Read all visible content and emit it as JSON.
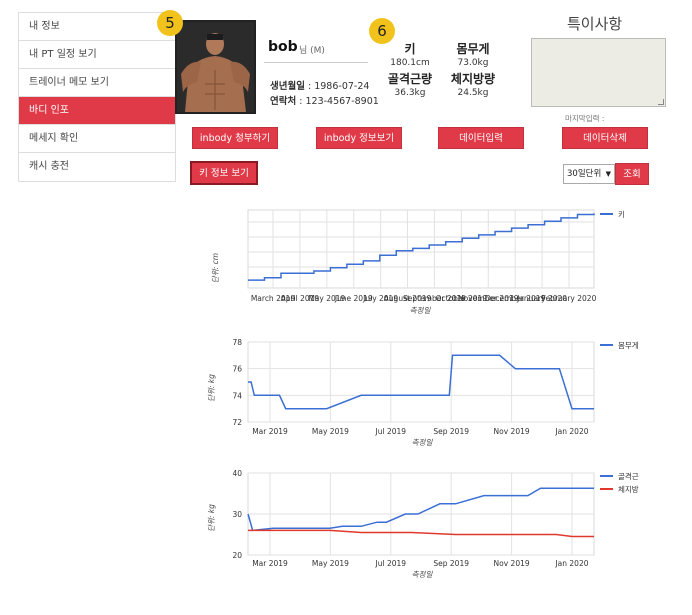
{
  "sidebar": {
    "items": [
      {
        "label": "내 정보",
        "active": false
      },
      {
        "label": "내 PT 일정 보기",
        "active": false
      },
      {
        "label": "트레이너 메모 보기",
        "active": false
      },
      {
        "label": "바디 인포",
        "active": true
      },
      {
        "label": "메세지 확인",
        "active": false
      },
      {
        "label": "캐시 충전",
        "active": false
      }
    ]
  },
  "markers": {
    "left": "5",
    "right": "6"
  },
  "profile": {
    "name": "bob",
    "name_suffix": "님 (M)",
    "birth_label": "생년월일",
    "birth_value": " : 1986-07-24",
    "phone_label": "연락처",
    "phone_value": " : 123-4567-8901"
  },
  "stats": {
    "height_label": "키",
    "height_value": "180.1cm",
    "weight_label": "몸무게",
    "weight_value": "73.0kg",
    "muscle_label": "골격근량",
    "muscle_value": "36.3kg",
    "fat_label": "체지방량",
    "fat_value": "24.5kg"
  },
  "notes": {
    "title": "특이사항",
    "last_input": "마지막입력 :"
  },
  "buttons": {
    "inbody_request": "inbody 청부하기",
    "inbody_view": "inbody 정보보기",
    "data_input": "데이터입력",
    "data_delete": "데이터삭제",
    "key_view": "키 정보 보기",
    "lookup": "조회"
  },
  "period_select": {
    "value": "30일단위"
  },
  "colors": {
    "accent": "#e03a48",
    "line_blue": "#3b6fd4",
    "line_red": "#e0392c",
    "badge": "#f2c21c"
  },
  "chart_data": [
    {
      "type": "line",
      "ylabel": "단위: cm",
      "xlabel": "측정일",
      "x_ticks": [
        "March 2019",
        "April 2019",
        "May 2019",
        "June 2019",
        "July 2019",
        "August 2019",
        "September 2019",
        "October 2019",
        "November 2019",
        "December 2019",
        "January 2020",
        "February 2020"
      ],
      "series": [
        {
          "name": "키",
          "color": "#3b6fd4",
          "values": [
            174.2,
            174.4,
            174.8,
            174.8,
            175.0,
            175.3,
            175.6,
            175.9,
            176.4,
            176.8,
            177.0,
            177.3,
            177.6,
            177.9,
            178.2,
            178.5,
            178.8,
            179.1,
            179.4,
            179.7,
            180.0,
            180.1
          ]
        }
      ]
    },
    {
      "type": "line",
      "ylabel": "단위: kg",
      "xlabel": "측정일",
      "y_ticks": [
        "72",
        "74",
        "76",
        "78"
      ],
      "ylim": [
        72,
        78
      ],
      "x_ticks": [
        "Mar 2019",
        "May 2019",
        "Jul 2019",
        "Sep 2019",
        "Nov 2019",
        "Jan 2020"
      ],
      "series": [
        {
          "name": "몸무게",
          "color": "#3b6fd4",
          "x": [
            0,
            0.1,
            0.2,
            1.0,
            1.2,
            1.6,
            2.5,
            3.6,
            3.8,
            4.8,
            5.2,
            6.0,
            6.4,
            6.5,
            6.7,
            7.6,
            7.7,
            8.0,
            8.5,
            9.0,
            9.3,
            9.9,
            10.3,
            11.0
          ],
          "values": [
            75,
            75,
            74,
            74,
            73,
            73,
            73,
            74,
            74,
            74,
            74,
            74,
            74,
            77,
            77,
            77,
            77,
            77,
            76,
            76,
            76,
            76,
            73,
            73
          ]
        }
      ]
    },
    {
      "type": "line",
      "ylabel": "단위: kg",
      "xlabel": "측정일",
      "y_ticks": [
        "20",
        "30",
        "40"
      ],
      "ylim": [
        20,
        40
      ],
      "x_ticks": [
        "Mar 2019",
        "May 2019",
        "Jul 2019",
        "Sep 2019",
        "Nov 2019",
        "Jan 2020"
      ],
      "series": [
        {
          "name": "골격근",
          "color": "#3b6fd4",
          "x": [
            0,
            0.15,
            0.8,
            2.6,
            3.0,
            3.6,
            4.1,
            4.4,
            5.0,
            5.4,
            6.1,
            6.6,
            7.5,
            8.0,
            8.9,
            9.3,
            10.0,
            11.0
          ],
          "values": [
            30,
            26,
            26.5,
            26.5,
            27,
            27,
            28,
            28,
            30,
            30,
            32.5,
            32.5,
            34.5,
            34.5,
            34.5,
            36.3,
            36.3,
            36.3
          ]
        },
        {
          "name": "체지방",
          "color": "#e0392c",
          "x": [
            0,
            1.0,
            2.6,
            3.6,
            4.4,
            5.2,
            6.6,
            7.7,
            8.9,
            9.8,
            10.3,
            11.0
          ],
          "values": [
            26,
            26,
            26,
            25.5,
            25.5,
            25.5,
            25,
            25,
            25,
            25,
            24.5,
            24.5
          ]
        }
      ]
    }
  ]
}
